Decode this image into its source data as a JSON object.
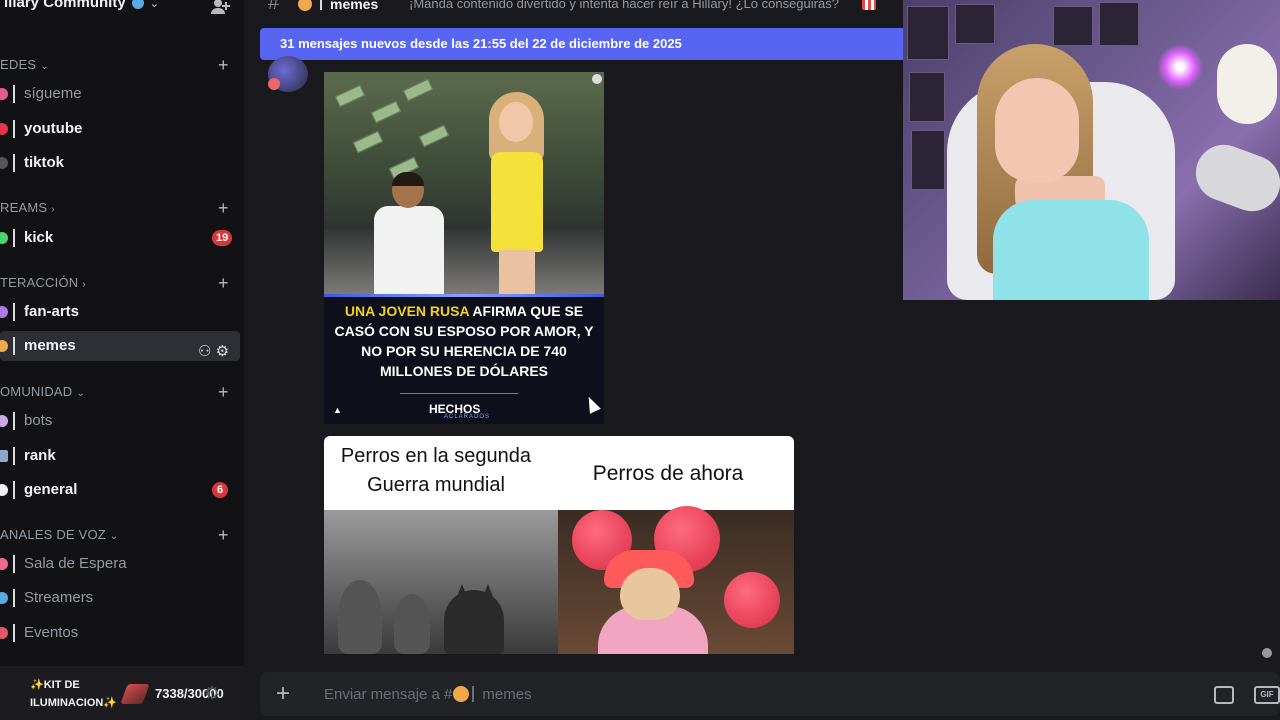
{
  "server": {
    "title": "illary Community"
  },
  "categories": {
    "redes": "EDES",
    "streams": "REAMS",
    "interaccion": "TERACCIÓN",
    "comunidad": "OMUNIDAD",
    "voz": "ANALES DE VOZ"
  },
  "channels": {
    "sigueme": "sígueme",
    "youtube": "youtube",
    "tiktok": "tiktok",
    "kick": "kick",
    "fanarts": "fan-arts",
    "memes": "memes",
    "bots": "bots",
    "rank": "rank",
    "general": "general",
    "sala": "Sala de Espera",
    "streamers": "Streamers",
    "eventos": "Eventos"
  },
  "badges": {
    "kick": "19",
    "general": "6"
  },
  "userbar": {
    "kit": "✨KIT DE ILUMINACION✨",
    "counter": "7338/30000"
  },
  "header": {
    "channel": "memes",
    "topic": "¡Manda contenido divertido y intenta hacer reír a Hillary! ¿Lo conseguirás?"
  },
  "new_messages_bar": "31 mensajes nuevos desde las 21:55 del 22 de diciembre de 2025",
  "meme1": {
    "line1_highlight": "UNA JOVEN RUSA",
    "line1_rest": " AFIRMA QUE SE CASÓ CON SU ESPOSO POR AMOR, Y NO POR SU HERENCIA DE 740 MILLONES DE DÓLARES",
    "logo": "HECHOS",
    "logo_sub": "ACLARADOS"
  },
  "meme2": {
    "left_title": "Perros en la segunda Guerra mundial",
    "right_title": "Perros de ahora"
  },
  "composer": {
    "placeholder_prefix": "Enviar mensaje a #",
    "placeholder_channel": "memes",
    "gif": "GIF"
  },
  "colors": {
    "accent": "#5865f2",
    "badge": "#da373c",
    "highlight": "#f4d21a"
  }
}
